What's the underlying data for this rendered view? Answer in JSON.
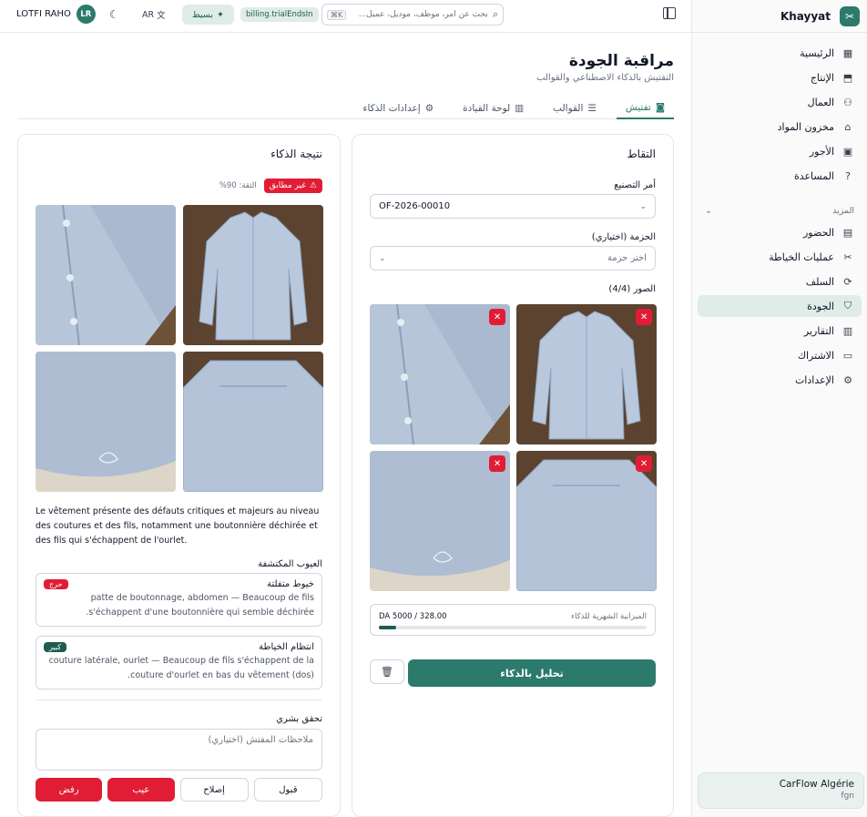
{
  "app": {
    "name": "Khayyat"
  },
  "sidebar": {
    "items": [
      {
        "label": "الرئيسية",
        "icon": "dashboard-icon"
      },
      {
        "label": "الإنتاج",
        "icon": "production-icon"
      },
      {
        "label": "العمال",
        "icon": "workers-icon"
      },
      {
        "label": "مخزون المواد",
        "icon": "warehouse-icon"
      },
      {
        "label": "الأجور",
        "icon": "wages-icon"
      },
      {
        "label": "المساعدة",
        "icon": "help-icon"
      }
    ],
    "more_label": "المزيد",
    "more_items": [
      {
        "label": "الحضور",
        "icon": "calendar-icon"
      },
      {
        "label": "عمليات الخياطة",
        "icon": "scissors-icon"
      },
      {
        "label": "السلف",
        "icon": "advance-icon"
      },
      {
        "label": "الجودة",
        "icon": "shield-check-icon",
        "active": true
      },
      {
        "label": "التقارير",
        "icon": "reports-icon"
      },
      {
        "label": "الاشتراك",
        "icon": "card-icon"
      },
      {
        "label": "الإعدادات",
        "icon": "gear-icon"
      }
    ],
    "org": {
      "name": "CarFlow Algérie",
      "sub": "fgn"
    }
  },
  "topbar": {
    "user_name": "LOTFI RAHO",
    "user_initials": "LR",
    "language": "AR",
    "mode_label": "بسيط",
    "trial_label": "billing.trialEndsIn",
    "search_placeholder": "بحث عن أمر، موظف، موديل، عميل...",
    "search_shortcut": "K⌘"
  },
  "page": {
    "title": "مراقبة الجودة",
    "subtitle": "التفتيش بالذكاء الاصطناعي والقوالب",
    "tabs": [
      {
        "label": "تفتيش",
        "icon": "camera-icon",
        "active": true
      },
      {
        "label": "القوالب",
        "icon": "checklist-icon"
      },
      {
        "label": "لوحة القيادة",
        "icon": "bar-chart-icon"
      },
      {
        "label": "إعدادات الذكاء",
        "icon": "gear-icon"
      }
    ]
  },
  "capture": {
    "title": "التقاط",
    "order_label": "أمر التصنيع",
    "order_value": "OF-2026-00010",
    "bundle_label": "الحزمة (اختياري)",
    "bundle_placeholder": "اختر حزمة",
    "photos_label": "الصور (4/4)",
    "budget_label": "الميزانية الشهرية للذكاء",
    "budget_amount": "DA 5000 / 328.00",
    "budget_used": 328,
    "budget_total": 5000,
    "analyze_label": "تحليل بالذكاء"
  },
  "result": {
    "title": "نتيجة الذكاء",
    "verdict": "غير مطابق",
    "confidence": "الثقة: 90%",
    "summary": "Le vêtement présente des défauts critiques et majeurs au niveau des coutures et des fils, notamment une boutonnière déchirée et des fils qui s'échappent de l'ourlet.",
    "defects_label": "العيوب المكتشفة",
    "defects": [
      {
        "name": "خيوط متفلتة",
        "severity": "حرج",
        "severity_color": "#e11d36",
        "description": "patte de boutonnage, abdomen — Beaucoup de fils s'échappent d'une boutonnière qui semble déchirée."
      },
      {
        "name": "انتظام الخياطة",
        "severity": "كبير",
        "severity_color": "#1f5c50",
        "description": "couture latérale, ourlet — Beaucoup de fils s'échappent de la couture d'ourlet en bas du vêtement (dos)."
      }
    ],
    "human_check_label": "تحقق بشري",
    "notes_placeholder": "ملاحظات المفتش (اختياري)",
    "actions": {
      "accept": "قبول",
      "repair": "إصلاح",
      "defect": "عيب",
      "reject": "رفض"
    }
  },
  "colors": {
    "accent": "#2c7a6b",
    "danger": "#e11d36",
    "accent_soft": "#dfece8"
  }
}
